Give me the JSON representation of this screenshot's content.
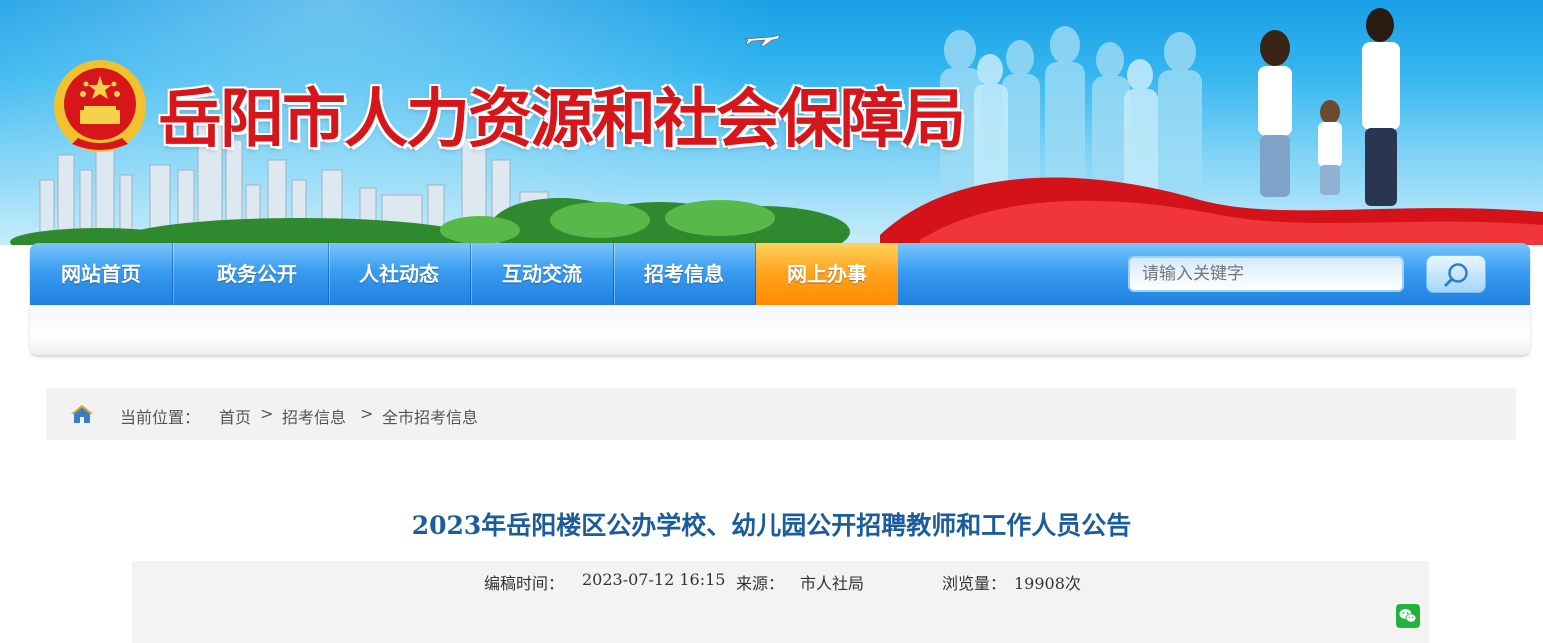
{
  "header": {
    "site_title": "岳阳市人力资源和社会保障局",
    "emblem_icon": "national-emblem-icon",
    "brand_red": "#d7161c",
    "sky_blue": "#35b6f0"
  },
  "nav": {
    "items": [
      {
        "label": "网站首页"
      },
      {
        "label": "政务公开"
      },
      {
        "label": "人社动态"
      },
      {
        "label": "互动交流"
      },
      {
        "label": "招考信息"
      },
      {
        "label": "网上办事",
        "active": true
      }
    ],
    "search_placeholder": "请输入关键字",
    "search_icon": "search-icon",
    "active_color": "#ff8a00"
  },
  "breadcrumb": {
    "prefix": "当前位置：",
    "home_icon": "home-icon",
    "items": [
      "首页",
      "招考信息",
      "全市招考信息"
    ],
    "separator": ">"
  },
  "article": {
    "title": "2023年岳阳楼区公办学校、幼儿园公开招聘教师和工作人员公告",
    "edit_time_label": "编稿时间：",
    "edit_time": "2023-07-12 16:15",
    "source_label": "来源：",
    "source": "市人社局",
    "views_label": "浏览量：",
    "views": "19908次",
    "share_icon": "wechat-icon"
  }
}
